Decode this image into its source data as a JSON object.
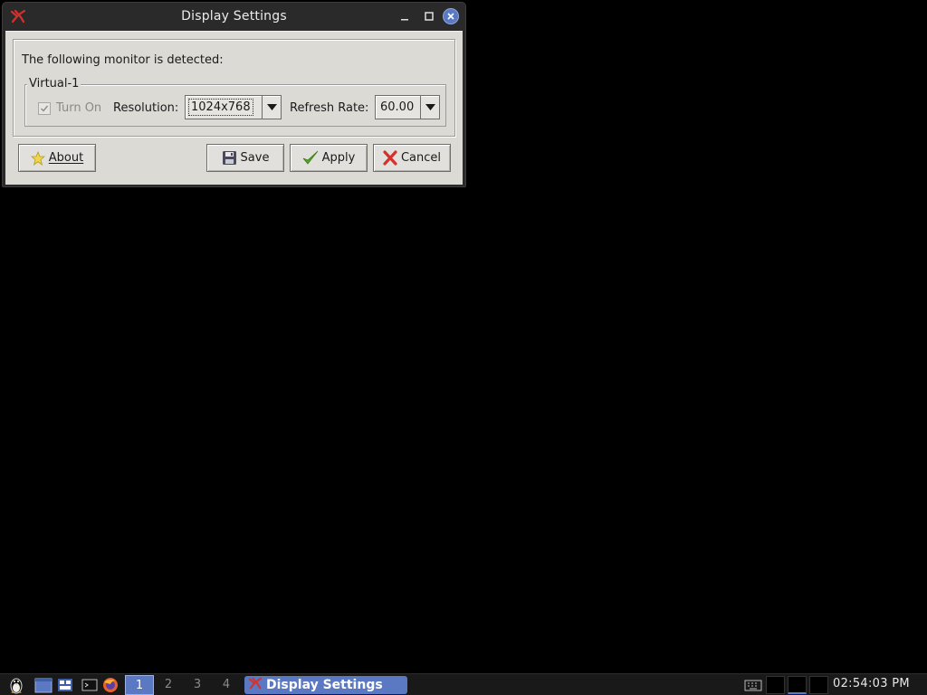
{
  "window": {
    "title": "Display Settings",
    "detect_label": "The following monitor is detected:",
    "monitor": {
      "name": "Virtual-1",
      "turn_on_label": "Turn On",
      "turn_on_checked": true,
      "resolution_label": "Resolution:",
      "resolution_value": "1024x768",
      "refresh_rate_label": "Refresh Rate:",
      "refresh_rate_value": "60.00"
    },
    "buttons": {
      "about": "About",
      "save": "Save",
      "apply": "Apply",
      "cancel": "Cancel"
    }
  },
  "taskbar": {
    "workspaces": [
      "1",
      "2",
      "3",
      "4"
    ],
    "active_workspace": "1",
    "task_label": "Display Settings",
    "clock": "02:54:03 PM"
  },
  "icons": {
    "app": "display-settings-icon",
    "menu": "tux-penguin-icon",
    "launchers": [
      "desktop-icon",
      "file-manager-icon",
      "terminal-icon",
      "firefox-icon"
    ],
    "tray": [
      "keyboard-icon"
    ]
  },
  "colors": {
    "accent": "#5b79c2",
    "dialog_bg": "#dcdad5",
    "titlebar": "#2a2a2a",
    "desktop": "#000000"
  }
}
